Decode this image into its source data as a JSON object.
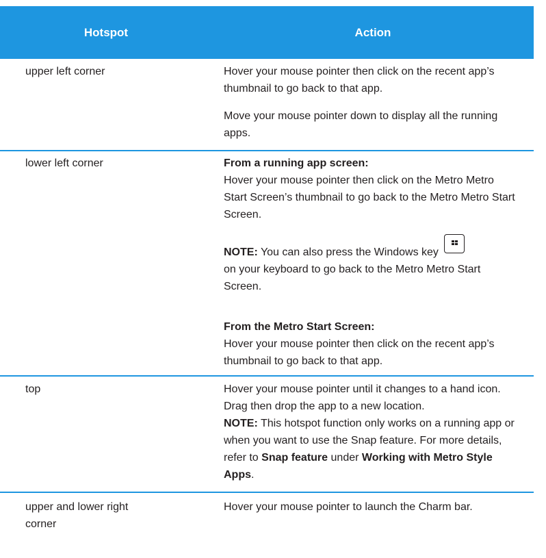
{
  "table": {
    "headers": {
      "hotspot": "Hotspot",
      "action": "Action"
    },
    "rows": [
      {
        "hotspot": "upper left corner",
        "action_p1": "Hover your mouse pointer then click on the recent app’s thumbnail to go back to that app.",
        "action_p2": "Move your mouse pointer down to display all the running apps."
      },
      {
        "hotspot": "lower left corner",
        "sub1_heading": "From a running app screen:",
        "sub1_text": "Hover your mouse pointer then click on the Metro Metro Start Screen’s thumbnail to go back to the Metro Metro Start Screen.",
        "note_label": "NOTE:",
        "note_text_before": "You can also press the Windows key",
        "note_text_after": "on your keyboard to go back to the Metro Metro Start Screen.",
        "sub2_heading": "From the Metro Start Screen:",
        "sub2_text": "Hover your mouse pointer then click on the recent app’s thumbnail to go back to that app."
      },
      {
        "hotspot": "top",
        "action_p1": "Hover your mouse pointer until it changes to a hand icon. Drag then drop the app to a new location.",
        "note_label": "NOTE:",
        "note_text_1": "This hotspot function only works on a running app or when you want to use the Snap feature. For more details, refer to",
        "note_bold_1": "Snap feature",
        "note_text_2": "under",
        "note_bold_2": "Working with Metro Style Apps",
        "note_text_3": "."
      },
      {
        "hotspot": "upper and lower right corner",
        "action_p1": "Hover your mouse pointer to launch the Charm bar."
      }
    ]
  },
  "icons": {
    "windows_key": "windows-key-icon"
  },
  "colors": {
    "header_bg": "#1e96e0",
    "header_text": "#ffffff",
    "separator": "#1e96e0",
    "text": "#231f20"
  }
}
